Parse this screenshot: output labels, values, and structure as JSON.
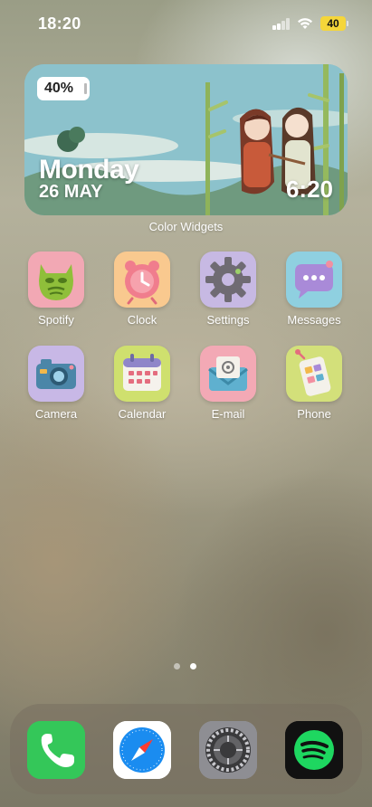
{
  "status_bar": {
    "time": "18:20",
    "battery": "40"
  },
  "widget": {
    "battery": "40%",
    "day": "Monday",
    "date": "26 MAY",
    "time": "6:20",
    "caption": "Color Widgets"
  },
  "apps": [
    {
      "label": "Spotify",
      "icon": "green-mask-icon",
      "bg": "#f2a8b4"
    },
    {
      "label": "Clock",
      "icon": "pink-alarm-clock-icon",
      "bg": "#f9c98f"
    },
    {
      "label": "Settings",
      "icon": "gear-icon",
      "bg": "#c7b9e3"
    },
    {
      "label": "Messages",
      "icon": "speech-bubble-icon",
      "bg": "#8fd0e0"
    },
    {
      "label": "Camera",
      "icon": "camera-icon",
      "bg": "#c8b8e6"
    },
    {
      "label": "Calendar",
      "icon": "calendar-icon",
      "bg": "#cfe06e"
    },
    {
      "label": "E-mail",
      "icon": "envelope-icon",
      "bg": "#f3a9b5"
    },
    {
      "label": "Phone",
      "icon": "smartphone-icon",
      "bg": "#d3e07a"
    }
  ],
  "dock": [
    {
      "name": "phone",
      "icon": "phone-handset-icon",
      "bg": "#34c759"
    },
    {
      "name": "safari",
      "icon": "compass-icon",
      "bg": "#ffffff"
    },
    {
      "name": "settings",
      "icon": "settings-gear-icon",
      "bg": "#9a9aa0"
    },
    {
      "name": "spotify",
      "icon": "spotify-logo-icon",
      "bg": "#111111"
    }
  ],
  "page_indicator": {
    "pages": 2,
    "current": 2
  }
}
